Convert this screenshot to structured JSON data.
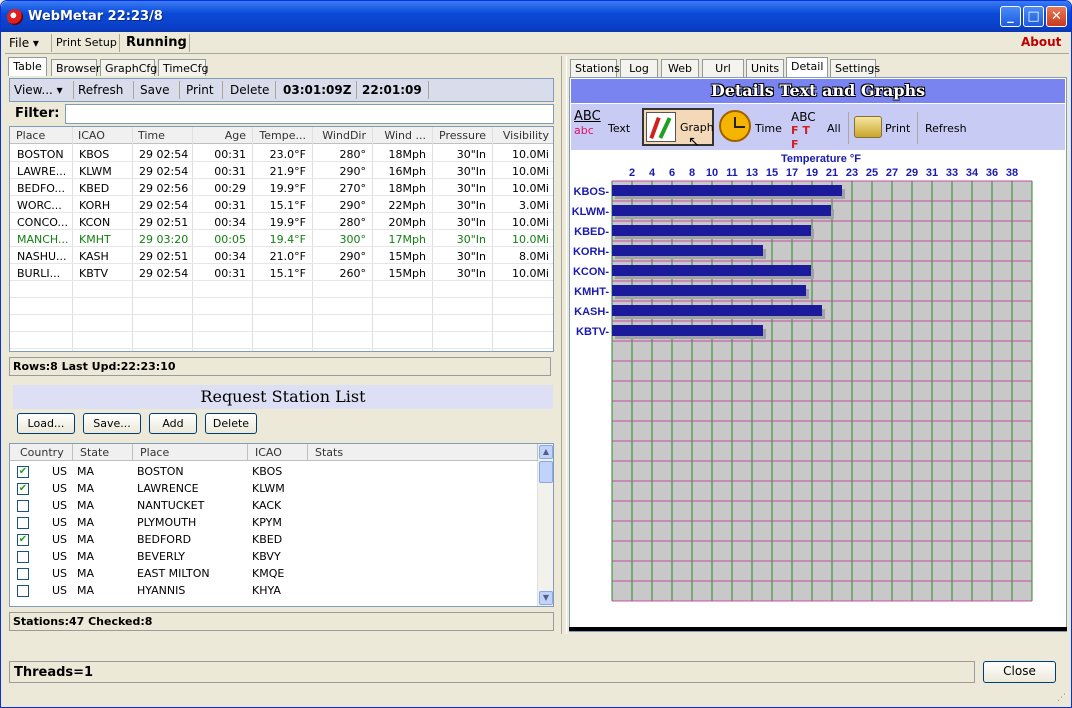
{
  "window": {
    "title": "WebMetar 22:23/8"
  },
  "menu": {
    "file": "File",
    "print_setup": "Print Setup",
    "status": "Running",
    "about": "About"
  },
  "left_tabs": [
    "Table",
    "Browser",
    "GraphCfg",
    "TimeCfg"
  ],
  "right_tabs": [
    "Stations",
    "Log",
    "Web",
    "Url",
    "Units",
    "Detail",
    "Settings"
  ],
  "toolbar": {
    "view": "View...",
    "refresh": "Refresh",
    "save": "Save",
    "print": "Print",
    "delete": "Delete",
    "utc_time": "03:01:09Z",
    "local_time": "22:01:09"
  },
  "filter": {
    "label": "Filter:",
    "value": ""
  },
  "obs_table": {
    "columns": [
      "Place",
      "ICAO",
      "Time",
      "Age",
      "Tempe...",
      "WindDir",
      "Wind ...",
      "Pressure",
      "Visibility"
    ],
    "rows": [
      [
        "BOSTON",
        "KBOS",
        "29 02:54",
        "00:31",
        "23.0°F",
        "280°",
        "18Mph",
        "30\"In",
        "10.0Mi"
      ],
      [
        "LAWRE...",
        "KLWM",
        "29 02:54",
        "00:31",
        "21.9°F",
        "290°",
        "16Mph",
        "30\"In",
        "10.0Mi"
      ],
      [
        "BEDFO...",
        "KBED",
        "29 02:56",
        "00:29",
        "19.9°F",
        "270°",
        "18Mph",
        "30\"In",
        "10.0Mi"
      ],
      [
        "WORC...",
        "KORH",
        "29 02:54",
        "00:31",
        "15.1°F",
        "290°",
        "22Mph",
        "30\"In",
        "3.0Mi"
      ],
      [
        "CONCO...",
        "KCON",
        "29 02:51",
        "00:34",
        "19.9°F",
        "280°",
        "20Mph",
        "30\"In",
        "10.0Mi"
      ],
      [
        "MANCH...",
        "KMHT",
        "29 03:20",
        "00:05",
        "19.4°F",
        "300°",
        "17Mph",
        "30\"In",
        "10.0Mi"
      ],
      [
        "NASHU...",
        "KASH",
        "29 02:51",
        "00:34",
        "21.0°F",
        "290°",
        "15Mph",
        "30\"In",
        "8.0Mi"
      ],
      [
        "BURLI...",
        "KBTV",
        "29 02:54",
        "00:31",
        "15.1°F",
        "260°",
        "15Mph",
        "30\"In",
        "10.0Mi"
      ]
    ],
    "highlight_row": 5,
    "highlight_color": "#108010"
  },
  "rows_status": "Rows:8  Last Upd:22:23:10",
  "request": {
    "title": "Request Station List",
    "buttons": [
      "Load...",
      "Save...",
      "Add",
      "Delete"
    ],
    "columns": [
      "Country",
      "State",
      "Place",
      "ICAO",
      "Stats"
    ],
    "rows": [
      {
        "checked": true,
        "country": "US",
        "state": "MA",
        "place": "BOSTON",
        "icao": "KBOS"
      },
      {
        "checked": true,
        "country": "US",
        "state": "MA",
        "place": "LAWRENCE",
        "icao": "KLWM"
      },
      {
        "checked": false,
        "country": "US",
        "state": "MA",
        "place": "NANTUCKET",
        "icao": "KACK"
      },
      {
        "checked": false,
        "country": "US",
        "state": "MA",
        "place": "PLYMOUTH",
        "icao": "KPYM"
      },
      {
        "checked": true,
        "country": "US",
        "state": "MA",
        "place": "BEDFORD",
        "icao": "KBED"
      },
      {
        "checked": false,
        "country": "US",
        "state": "MA",
        "place": "BEVERLY",
        "icao": "KBVY"
      },
      {
        "checked": false,
        "country": "US",
        "state": "MA",
        "place": "EAST MILTON",
        "icao": "KMQE"
      },
      {
        "checked": false,
        "country": "US",
        "state": "MA",
        "place": "HYANNIS",
        "icao": "KHYA"
      }
    ],
    "status": "Stations:47   Checked:8"
  },
  "detail": {
    "title": "Details Text and Graphs",
    "tools": {
      "text": "Text",
      "graph": "Graph",
      "time": "Time",
      "all": "All",
      "print": "Print",
      "refresh": "Refresh"
    }
  },
  "chart_data": {
    "type": "bar",
    "title": "Temperature °F",
    "categories": [
      "KBOS-",
      "KLWM-",
      "KBED-",
      "KORH-",
      "KCON-",
      "KMHT-",
      "KASH-",
      "KBTV-"
    ],
    "values": [
      23.0,
      21.9,
      19.9,
      15.1,
      19.9,
      19.4,
      21.0,
      15.1
    ],
    "x_ticks": [
      "2",
      "4",
      "6",
      "8",
      "10",
      "11",
      "13",
      "15",
      "17",
      "19",
      "21",
      "23",
      "25",
      "27",
      "29",
      "31",
      "33",
      "34",
      "36",
      "38"
    ],
    "bar_color": "#1a1a9a",
    "grid": true
  },
  "footer": {
    "threads": "Threads=1",
    "close": "Close"
  }
}
